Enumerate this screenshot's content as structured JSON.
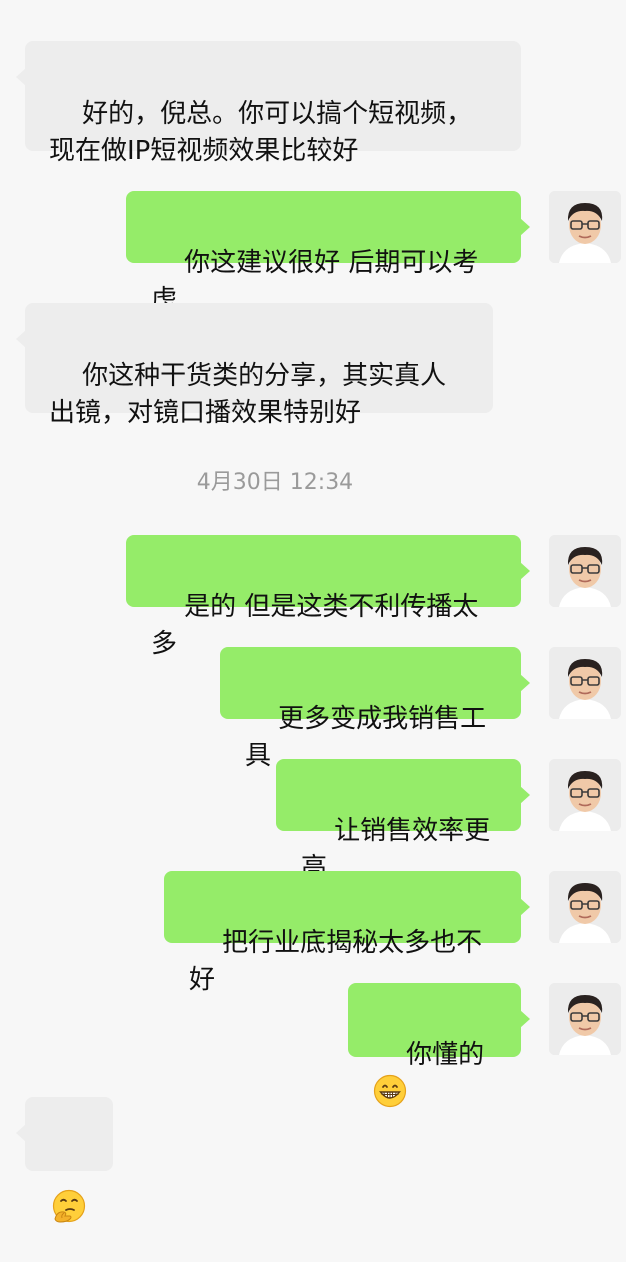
{
  "messages": [
    {
      "side": "in",
      "text": "好的，倪总。你可以搞个短视频，现在做IP短视频效果比较好"
    },
    {
      "side": "out",
      "text": "你这建议很好 后期可以考虑"
    },
    {
      "side": "in",
      "text": "你这种干货类的分享，其实真人出镜，对镜口播效果特别好"
    },
    {
      "side": "out",
      "text": "是的 但是这类不利传播太多"
    },
    {
      "side": "out",
      "text": "更多变成我销售工具"
    },
    {
      "side": "out",
      "text": "让销售效率更高"
    },
    {
      "side": "out",
      "text": "把行业底揭秘太多也不好"
    },
    {
      "side": "out",
      "text": "你懂的",
      "emoji": "grinning-face-icon"
    },
    {
      "side": "in",
      "text": "",
      "emoji": "thinking-face-icon"
    }
  ],
  "timestamp": "4月30日 12:34",
  "colors": {
    "background": "#f7f7f7",
    "incoming_bubble": "#ededed",
    "outgoing_bubble": "#95ec69",
    "timestamp_text": "#9a9a9a"
  }
}
